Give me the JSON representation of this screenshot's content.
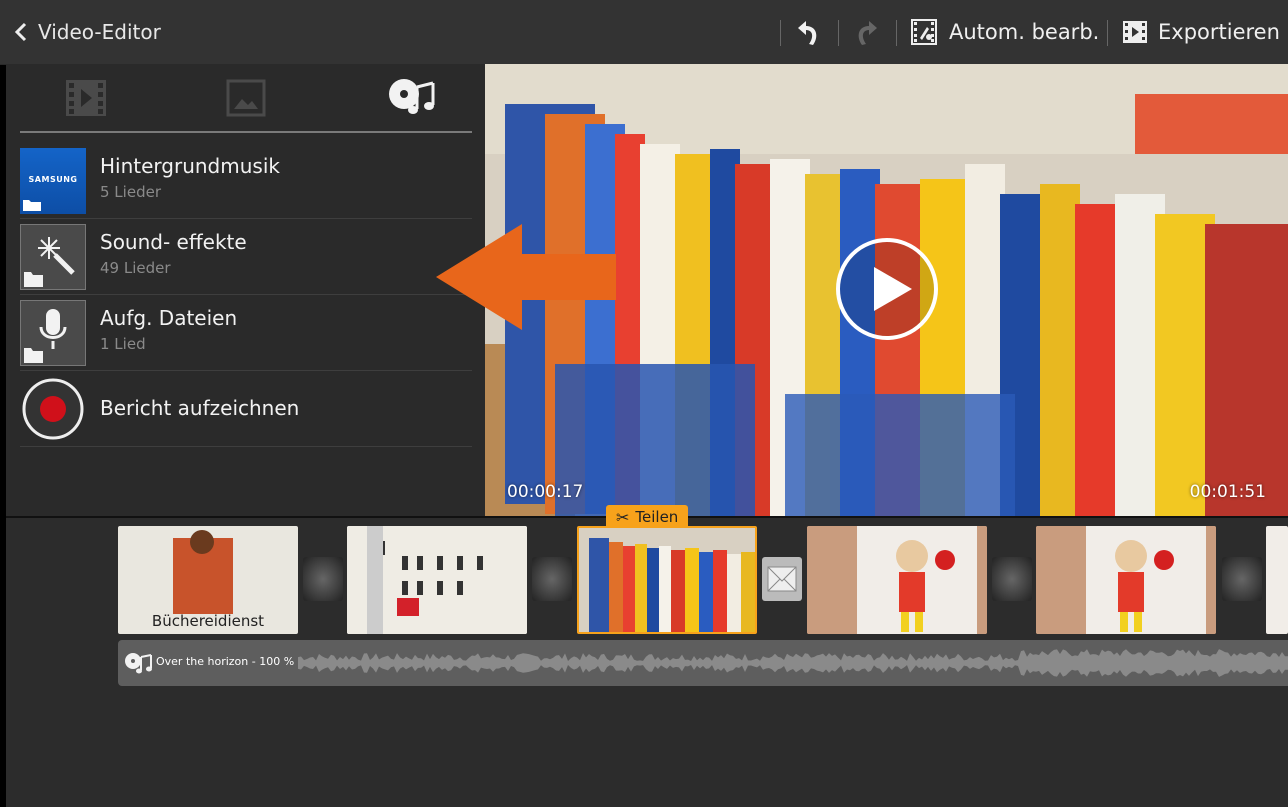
{
  "topbar": {
    "title": "Video-Editor",
    "auto_edit_label": "Autom. bearb.",
    "export_label": "Exportieren"
  },
  "panel": {
    "tabs": [
      "film-strip-icon",
      "image-icon",
      "music-icon"
    ],
    "items": [
      {
        "title": "Hintergrundmusik",
        "subtitle": "5 Lieder",
        "icon": "samsung-folder-icon",
        "brand": "SAMSUNG"
      },
      {
        "title": "Sound- effekte",
        "subtitle": "49 Lieder",
        "icon": "magic-wand-folder-icon"
      },
      {
        "title": "Aufg. Dateien",
        "subtitle": "1 Lied",
        "icon": "microphone-folder-icon"
      },
      {
        "title": "Bericht aufzeichnen",
        "icon": "record-icon"
      }
    ]
  },
  "video": {
    "current_time": "00:00:17",
    "total_time": "00:01:51"
  },
  "timeline": {
    "split_label": "Teilen",
    "clip1_caption": "Büchereidienst",
    "audio_track": "Over the horizon - 100 %"
  },
  "colors": {
    "accent": "#f7a21b",
    "arrow": "#e8661b",
    "record": "#d0101a"
  }
}
